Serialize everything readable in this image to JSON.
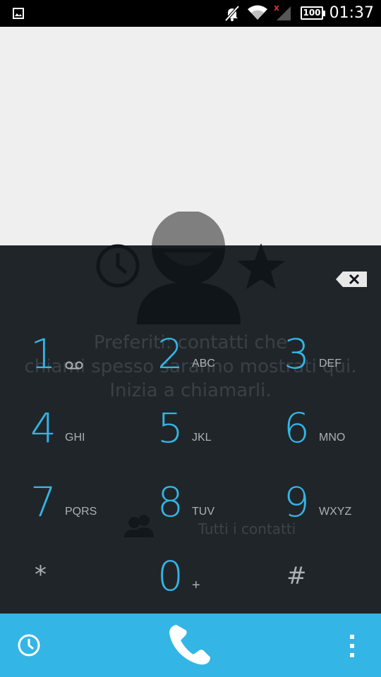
{
  "status_bar": {
    "time": "01:37",
    "battery": "100",
    "icons": [
      "image-icon",
      "mute-icon",
      "wifi-icon",
      "no-signal-icon",
      "battery-icon"
    ]
  },
  "favorites": {
    "empty_text_line1": "Preferiti: contatti che",
    "empty_text_line2": "chiami spesso saranno mostrati qui.",
    "empty_text_line3": "Inizia a chiamarli.",
    "all_contacts_label": "Tutti i contatti",
    "icons": [
      "recent-clock-icon",
      "contact-avatar-icon",
      "star-icon",
      "people-icon"
    ]
  },
  "dialpad": {
    "keys": [
      {
        "digit": "1",
        "letters": ""
      },
      {
        "digit": "2",
        "letters": "ABC"
      },
      {
        "digit": "3",
        "letters": "DEF"
      },
      {
        "digit": "4",
        "letters": "GHI"
      },
      {
        "digit": "5",
        "letters": "JKL"
      },
      {
        "digit": "6",
        "letters": "MNO"
      },
      {
        "digit": "7",
        "letters": "PQRS"
      },
      {
        "digit": "8",
        "letters": "TUV"
      },
      {
        "digit": "9",
        "letters": "WXYZ"
      },
      {
        "digit": "*",
        "letters": ""
      },
      {
        "digit": "0",
        "letters": "+"
      },
      {
        "digit": "#",
        "letters": ""
      }
    ]
  },
  "bottom_bar": {
    "icons": [
      "history-clock-icon",
      "phone-icon",
      "overflow-menu-icon"
    ],
    "color": "#33b5e5"
  },
  "colors": {
    "accent": "#33b5e5",
    "dialpad_bg": "#10161a"
  }
}
